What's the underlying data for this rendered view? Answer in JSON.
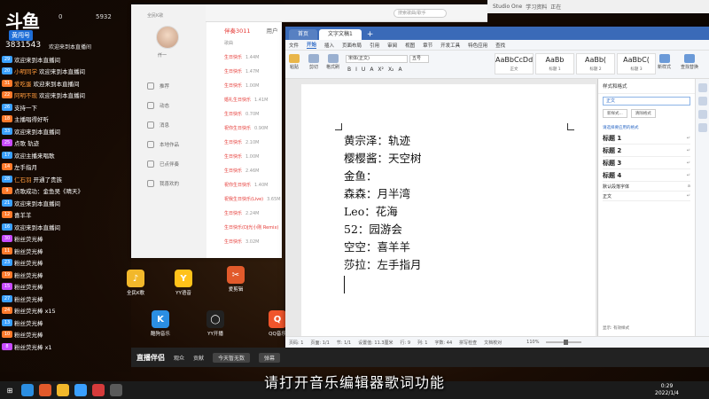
{
  "chat": {
    "logo": "斗鱼",
    "logo_sub": "黄闯号",
    "viewer_count": "0",
    "fans": "5932",
    "room_id": "3831543",
    "welcome": "欢迎来到本直播间",
    "messages": [
      {
        "badge": "29",
        "badge_color": "#3aa0ff",
        "name": "",
        "text": "欢迎来到本直播间"
      },
      {
        "badge": "20",
        "badge_color": "#3aa0ff",
        "name": "小明同学",
        "text": "欢迎来到本直播间"
      },
      {
        "badge": "31",
        "badge_color": "#ff7a2b",
        "name": "爱吃蛋",
        "text": "欢迎来到本直播间"
      },
      {
        "badge": "22",
        "badge_color": "#ff7a2b",
        "name": "阿明不现",
        "text": "欢迎来到本直播间"
      },
      {
        "badge": "26",
        "badge_color": "#3aa0ff",
        "name": "",
        "text": "支持一下"
      },
      {
        "badge": "18",
        "badge_color": "#ff7a2b",
        "name": "",
        "text": "主播唱得好听"
      },
      {
        "badge": "33",
        "badge_color": "#3aa0ff",
        "name": "",
        "text": "欢迎来到本直播间"
      },
      {
        "badge": "25",
        "badge_color": "#c84bff",
        "name": "",
        "text": "点歌 轨迹"
      },
      {
        "badge": "17",
        "badge_color": "#3aa0ff",
        "name": "",
        "text": "欢迎主播来唱歌"
      },
      {
        "badge": "14",
        "badge_color": "#ff7a2b",
        "name": "",
        "text": "左手指月"
      },
      {
        "badge": "28",
        "badge_color": "#3aa0ff",
        "name": "仁石羽",
        "text": "开通了贵族"
      },
      {
        "badge": "9",
        "badge_color": "#ff7a2b",
        "name": "",
        "text": "点歌成功：金鱼吴《晴天》"
      },
      {
        "badge": "21",
        "badge_color": "#3aa0ff",
        "name": "",
        "text": "欢迎来到本直播间"
      },
      {
        "badge": "12",
        "badge_color": "#ff7a2b",
        "name": "",
        "text": "喜羊羊"
      },
      {
        "badge": "16",
        "badge_color": "#3aa0ff",
        "name": "",
        "text": "欢迎来到本直播间"
      },
      {
        "badge": "30",
        "badge_color": "#c84bff",
        "name": "",
        "text": "粉丝荧光棒"
      },
      {
        "badge": "11",
        "badge_color": "#ff7a2b",
        "name": "",
        "text": "粉丝荧光棒"
      },
      {
        "badge": "23",
        "badge_color": "#3aa0ff",
        "name": "",
        "text": "粉丝荧光棒"
      },
      {
        "badge": "19",
        "badge_color": "#ff7a2b",
        "name": "",
        "text": "粉丝荧光棒"
      },
      {
        "badge": "15",
        "badge_color": "#c84bff",
        "name": "",
        "text": "粉丝荧光棒"
      },
      {
        "badge": "27",
        "badge_color": "#3aa0ff",
        "name": "",
        "text": "粉丝荧光棒"
      },
      {
        "badge": "24",
        "badge_color": "#ff7a2b",
        "name": "",
        "text": "粉丝荧光棒 x15"
      },
      {
        "badge": "13",
        "badge_color": "#3aa0ff",
        "name": "",
        "text": "粉丝荧光棒"
      },
      {
        "badge": "10",
        "badge_color": "#ff7a2b",
        "name": "",
        "text": "粉丝荧光棒"
      },
      {
        "badge": "8",
        "badge_color": "#c84bff",
        "name": "",
        "text": "粉丝荧光棒 x1"
      }
    ]
  },
  "music": {
    "title": "全民K歌",
    "user_name": "仟一",
    "nav": [
      "推荐",
      "动态",
      "消息",
      "本地作品",
      "已点伴奏",
      "我喜欢的"
    ],
    "tabs": [
      "伴奏3011",
      "用户"
    ],
    "header_col": "歌曲",
    "songs": [
      {
        "name": "生日快乐",
        "size": "1.44M"
      },
      {
        "name": "生日快乐",
        "size": "1.47M"
      },
      {
        "name": "生日快乐",
        "size": "1.00M"
      },
      {
        "name": "婚礼生日快乐",
        "size": "1.41M"
      },
      {
        "name": "生日快乐",
        "size": "0.70M"
      },
      {
        "name": "祝你生日快乐",
        "size": "0.90M"
      },
      {
        "name": "生日快乐",
        "size": "2.10M"
      },
      {
        "name": "生日快乐",
        "size": "1.00M"
      },
      {
        "name": "生日快乐",
        "size": "2.46M"
      },
      {
        "name": "祝你生日快乐",
        "size": "1.40M"
      },
      {
        "name": "祝我生日快乐(Live)",
        "size": "3.65M"
      },
      {
        "name": "生日快乐",
        "size": "2.24M"
      },
      {
        "name": "生日快乐(DJ光小刚 Remix)",
        "size": ""
      },
      {
        "name": "生日快乐",
        "size": "3.02M"
      }
    ]
  },
  "wps_bg": {
    "search_placeholder": "搜索歌曲/歌手",
    "app_strip": [
      "Studio One",
      "学习资料",
      "正在"
    ]
  },
  "wps": {
    "tabs": {
      "home": "首页",
      "doc": "文字文稿1"
    },
    "menu": [
      "文件",
      "开始",
      "插入",
      "页面布局",
      "引用",
      "审阅",
      "视图",
      "章节",
      "开发工具",
      "特色应用",
      "查找"
    ],
    "menu_active": "开始",
    "font_name": "宋体(正文)",
    "font_size": "五号",
    "format_buttons": [
      "B",
      "I",
      "U",
      "A",
      "X²",
      "X₂",
      "A"
    ],
    "ribbon_left": [
      "粘贴",
      "剪切",
      "复制",
      "格式刷"
    ],
    "styles": [
      {
        "preview": "AaBbCcDd",
        "name": "正文"
      },
      {
        "preview": "AaBb",
        "name": "标题 1"
      },
      {
        "preview": "AaBb(",
        "name": "标题 2"
      },
      {
        "preview": "AaBbC(",
        "name": "标题 3"
      }
    ],
    "ribbon_right": [
      "新样式",
      "文字工具",
      "查找替换",
      "选择"
    ],
    "lyrics": [
      "黄宗泽：轨迹",
      "樱樱酱：天空树",
      "金鱼：",
      "森森：月半湾",
      "Leo：花海",
      "52：园游会",
      "空空：喜羊羊",
      "莎拉：左手指月"
    ],
    "panel": {
      "title": "样式和格式",
      "current": "正文",
      "btn_new": "新样式...",
      "btn_clear": "清除格式",
      "sub": "请选择要应用的格式",
      "items": [
        {
          "name": "标题 1",
          "mark": "↵"
        },
        {
          "name": "标题 2",
          "mark": "↵"
        },
        {
          "name": "标题 3",
          "mark": "↵"
        },
        {
          "name": "标题 4",
          "mark": "↵"
        }
      ],
      "default_para": "默认段落字体",
      "default_mark": "a",
      "normal": "正文",
      "footer": "显示: 有效样式"
    },
    "status": {
      "page": "页码: 1",
      "pages": "页面: 1/1",
      "section": "节: 1/1",
      "settings": "设置值: 11.3厘米",
      "row": "行: 9",
      "col": "列: 1",
      "words": "字数: 44",
      "spell": "拼写检查",
      "doc": "文档校对",
      "zoom": "110%"
    }
  },
  "desktop_icons": [
    {
      "label": "全民K歌",
      "glyph": "♪",
      "color": "#f2b82b"
    },
    {
      "label": "YY语音",
      "glyph": "Y",
      "color": "#ffc21a"
    },
    {
      "label": "爱剪辑",
      "glyph": "✂",
      "color": "#e25a2b"
    },
    {
      "label": "酷狗音乐",
      "glyph": "K",
      "color": "#2b8ee2"
    },
    {
      "label": "YY开播",
      "glyph": "◯",
      "color": "#222"
    },
    {
      "label": "QQ音乐",
      "glyph": "Q",
      "color": "#f0552b"
    }
  ],
  "streambar": {
    "brand": "直播伴侣",
    "items": [
      "观众",
      "贡献",
      "今天暂无数",
      "弹幕"
    ]
  },
  "taskbar": {
    "time": "0:29",
    "date": "2022/1/4"
  },
  "subtitle": "请打开音乐编辑器歌词功能"
}
